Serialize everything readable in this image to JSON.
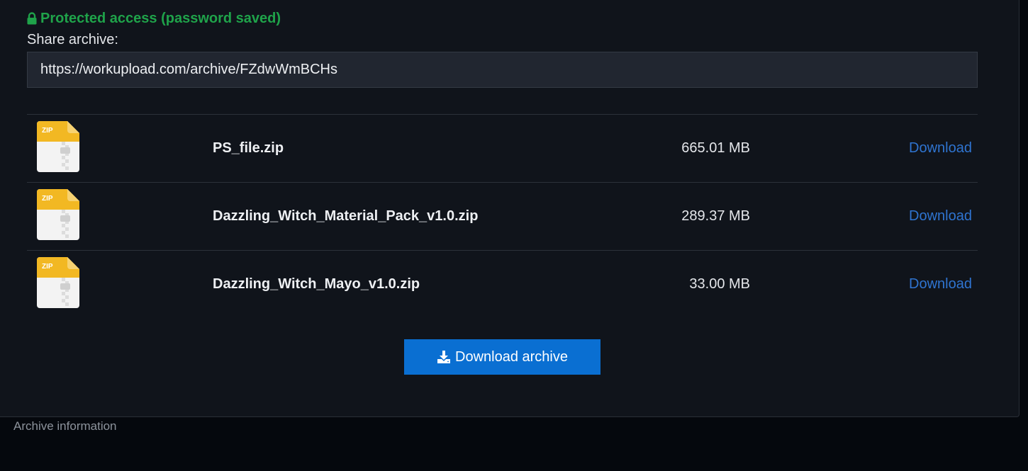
{
  "protected": {
    "text": "Protected access (password saved)",
    "color": "#1fa34a"
  },
  "share": {
    "label": "Share archive:",
    "url": "https://workupload.com/archive/FZdwWmBCHs"
  },
  "files": [
    {
      "icon_label": "ZIP",
      "name": "PS_file.zip",
      "size": "665.01 MB",
      "download_label": "Download"
    },
    {
      "icon_label": "ZIP",
      "name": "Dazzling_Witch_Material_Pack_v1.0.zip",
      "size": "289.37 MB",
      "download_label": "Download"
    },
    {
      "icon_label": "ZIP",
      "name": "Dazzling_Witch_Mayo_v1.0.zip",
      "size": "33.00 MB",
      "download_label": "Download"
    }
  ],
  "download_archive": {
    "label": "Download archive",
    "icon": "download-icon",
    "color": "#0a6fd2"
  },
  "footer": {
    "archive_info_label": "Archive information"
  },
  "colors": {
    "link": "#2f74d0",
    "panel": "#10141b",
    "page": "#05080d"
  }
}
